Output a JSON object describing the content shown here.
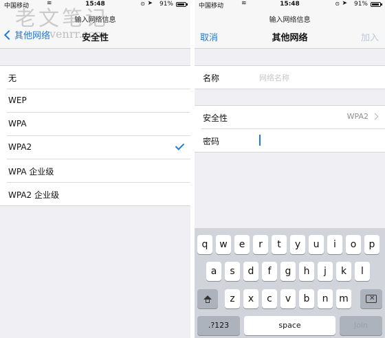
{
  "colors": {
    "accent": "#1f7ad6",
    "background": "#efeff4",
    "keyboard": "#d1d4da"
  },
  "left": {
    "status": {
      "carrier": "中国移动",
      "time": "15:48",
      "battery": "91%"
    },
    "nav": {
      "prompt": "输入网络信息",
      "back": "其他网络",
      "title": "安全性"
    },
    "options": [
      {
        "label": "无"
      },
      {
        "label": "WEP"
      },
      {
        "label": "WPA"
      },
      {
        "label": "WPA2",
        "selected": true
      },
      {
        "label": "WPA 企业级"
      },
      {
        "label": "WPA2 企业级"
      }
    ]
  },
  "right": {
    "status": {
      "carrier": "中国移动",
      "time": "15:48",
      "battery": "91%"
    },
    "nav": {
      "prompt": "输入网络信息",
      "cancel": "取消",
      "title": "其他网络",
      "join": "加入"
    },
    "name": {
      "label": "名称",
      "placeholder": "网络名称"
    },
    "security": {
      "label": "安全性",
      "value": "WPA2"
    },
    "password": {
      "label": "密码"
    },
    "keyboard": {
      "row1": [
        "q",
        "w",
        "e",
        "r",
        "t",
        "y",
        "u",
        "i",
        "o",
        "p"
      ],
      "row2": [
        "a",
        "s",
        "d",
        "f",
        "g",
        "h",
        "j",
        "k",
        "l"
      ],
      "row3": [
        "z",
        "x",
        "c",
        "v",
        "b",
        "n",
        "m"
      ],
      "numbers": ".?123",
      "space": "space",
      "join": "Join"
    }
  },
  "watermark": {
    "title": "老文笔记",
    "url": "venrr.com"
  }
}
